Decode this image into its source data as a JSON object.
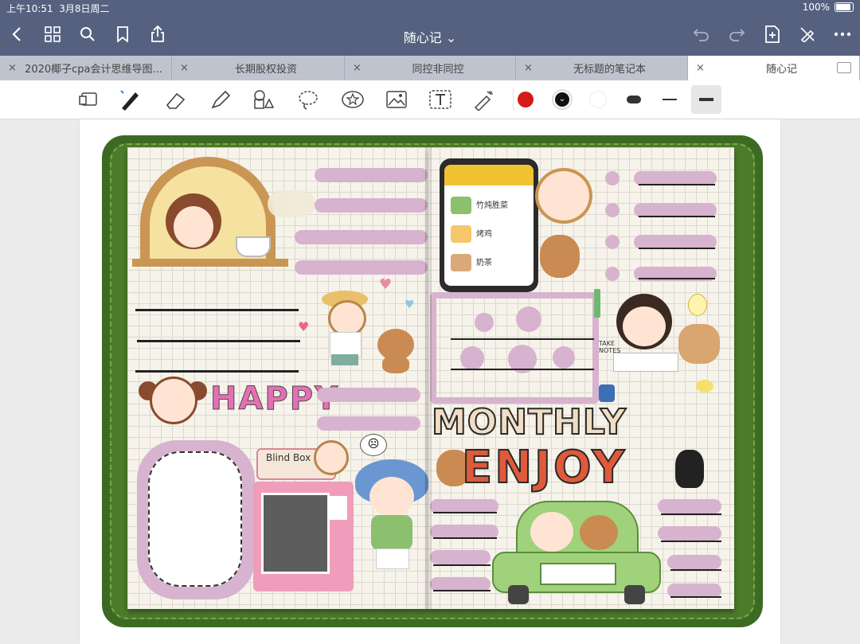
{
  "status": {
    "time": "上午10:51",
    "date": "3月8日周二",
    "battery": "100%"
  },
  "title": "随心记",
  "tabs": [
    {
      "label": "2020椰子cpa会计思维导图..."
    },
    {
      "label": "长期股权投资"
    },
    {
      "label": "同控非同控"
    },
    {
      "label": "无标题的笔记本"
    },
    {
      "label": "随心记"
    }
  ],
  "colors": {
    "topbar": "#55617f",
    "accent_red": "#d81919",
    "cover_green": "#3c6a22",
    "label_pink": "#d7b3cf"
  },
  "stickers": {
    "happy": "HAPPY",
    "blindbox": "Blind Box",
    "monthly": "MONTHLY",
    "enjoy": "ENJOY",
    "take_notes": "TAKE NOTES",
    "menu1": "竹炖胜菜",
    "menu2": "烤鸡",
    "menu3": "奶茶"
  },
  "icons": [
    "back-icon",
    "grid-icon",
    "search-icon",
    "bookmark-icon",
    "share-icon",
    "undo-icon",
    "redo-icon",
    "add-page-icon",
    "pen-off-icon",
    "more-icon"
  ]
}
